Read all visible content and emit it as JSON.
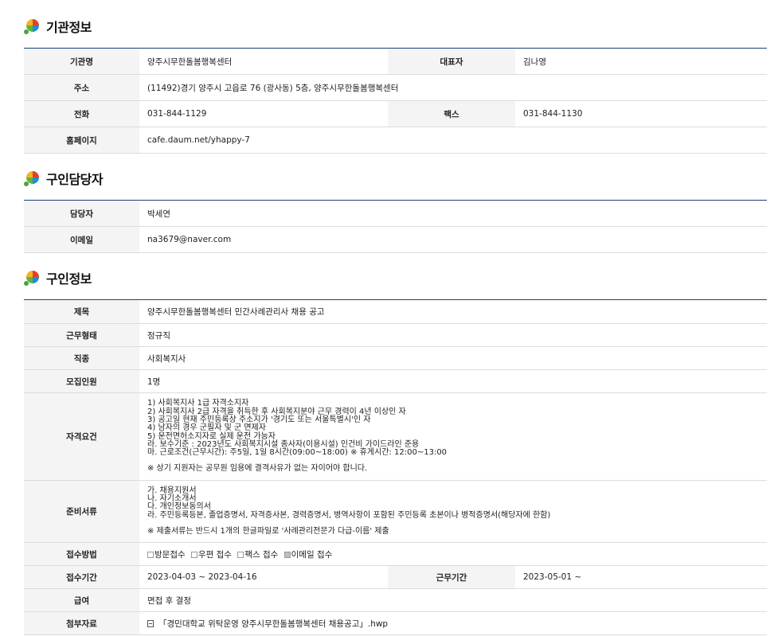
{
  "sections": {
    "org": "기관정보",
    "contact": "구인담당자",
    "job": "구인정보"
  },
  "org": {
    "name_label": "기관명",
    "name": "양주시무한돌봄행복센터",
    "rep_label": "대표자",
    "rep": "김나영",
    "addr_label": "주소",
    "addr": "(11492)경기 양주시 고읍로 76 (광사동) 5층, 양주시무한돌봄행복센터",
    "tel_label": "전화",
    "tel": "031-844-1129",
    "fax_label": "팩스",
    "fax": "031-844-1130",
    "home_label": "홈페이지",
    "home": "cafe.daum.net/yhappy-7"
  },
  "contact": {
    "person_label": "담당자",
    "person": "박세연",
    "email_label": "이메일",
    "email": "na3679@naver.com"
  },
  "job": {
    "title_label": "제목",
    "title": "양주시무한돌봄행복센터 민간사례관리사 채용 공고",
    "type_label": "근무형태",
    "type": "정규직",
    "occupation_label": "직종",
    "occupation": "사회복지사",
    "count_label": "모집인원",
    "count": "1명",
    "qual_label": "자격요건",
    "qual_lines": [
      "1) 사회복지사 1급 자격소지자",
      "2) 사회복지사 2급 자격을 취득한 후 사회복지분야 근무 경력이 4년 이상인 자",
      "3) 공고일 현재 주민등록상 주소지가 '경기도 또는 서울특별시'인 자",
      "4) 남자의 경우 군필자 및 군 면제자",
      "5) 운전면허소지자로 실제 운전 가능자",
      "라. 보수기준 : 2023년도 사회복지시설 종사자(이용시설) 인건비 가이드라인 준용",
      "마. 근로조건(근무시간): 주5일, 1일 8시간(09:00~18:00) ※ 휴게시간: 12:00~13:00"
    ],
    "qual_note": "※ 상기 지원자는 공무원 임용에 결격사유가 없는 자이어야 합니다.",
    "docs_label": "준비서류",
    "docs_lines": [
      "가. 채용지원서",
      "나. 자기소개서",
      "다. 개인정보동의서",
      "라. 주민등록등본, 졸업증명서, 자격증사본, 경력증명서, 병역사항이 포함된 주민등록 초본이나 병적증명서(해당자에 한함)"
    ],
    "docs_note": "※ 제출서류는 반드시 1개의 한글파일로 '사례관리전문가 다급-이름' 제출",
    "method_label": "접수방법",
    "methods": [
      {
        "label": "방문접수",
        "checked": false
      },
      {
        "label": "우편 접수",
        "checked": false
      },
      {
        "label": "팩스 접수",
        "checked": false
      },
      {
        "label": "이메일 접수",
        "checked": true
      }
    ],
    "period_label": "접수기간",
    "period": "2023-04-03 ~ 2023-04-16",
    "work_period_label": "근무기간",
    "work_period": "2023-05-01 ~",
    "salary_label": "급여",
    "salary": "면접 후 결정",
    "attach_label": "첨부자료",
    "attach": "「경민대학교 위탁운영 양주시무한돌봄행복센터 채용공고」.hwp"
  }
}
